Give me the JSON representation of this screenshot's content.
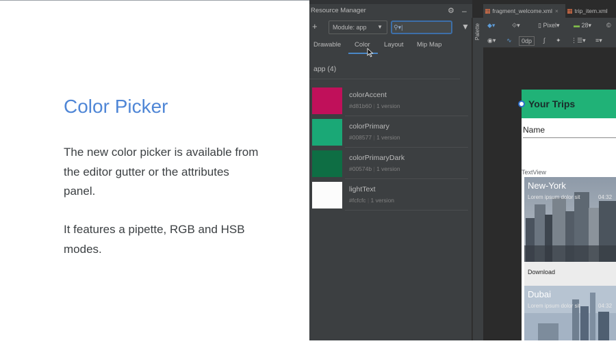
{
  "slide": {
    "title": "Color Picker",
    "paragraph1": "The new color picker is available from the editor gutter or the attributes panel.",
    "paragraph2": "It features a pipette, RGB and HSB modes."
  },
  "resource_manager": {
    "title": "Resource Manager",
    "module_label": "Module: app",
    "search_value": "",
    "tabs": [
      "Drawable",
      "Color",
      "Layout",
      "Mip Map"
    ],
    "active_tab": "Color",
    "group_label": "app (4)",
    "colors": [
      {
        "name": "colorAccent",
        "hex": "#d81b60",
        "versions": "1 version",
        "swatch": "#c0105a"
      },
      {
        "name": "colorPrimary",
        "hex": "#008577",
        "versions": "1 version",
        "swatch": "#1aa876"
      },
      {
        "name": "colorPrimaryDark",
        "hex": "#00574b",
        "versions": "1 version",
        "swatch": "#0e6e44"
      },
      {
        "name": "lightText",
        "hex": "#fcfcfc",
        "versions": "1 version",
        "swatch": "#fcfcfc"
      }
    ]
  },
  "palette_label": "Palette",
  "editor": {
    "tabs": [
      {
        "label": "fragment_welcome.xml"
      },
      {
        "label": "trip_item.xml"
      }
    ],
    "device": "Pixel",
    "api_level": "28",
    "margin": "0dp"
  },
  "preview": {
    "app_bar_title": "Your Trips",
    "name_label": "Name",
    "textview_label": "TextView",
    "cards": [
      {
        "city": "New-York",
        "subtitle": "Lorem ipsum dolor sit",
        "time": "04:32",
        "action": "Download"
      },
      {
        "city": "Dubai",
        "subtitle": "Lorem ipsum dolor sit",
        "time": "04:32"
      }
    ],
    "app_bar_color": "#20b277"
  }
}
